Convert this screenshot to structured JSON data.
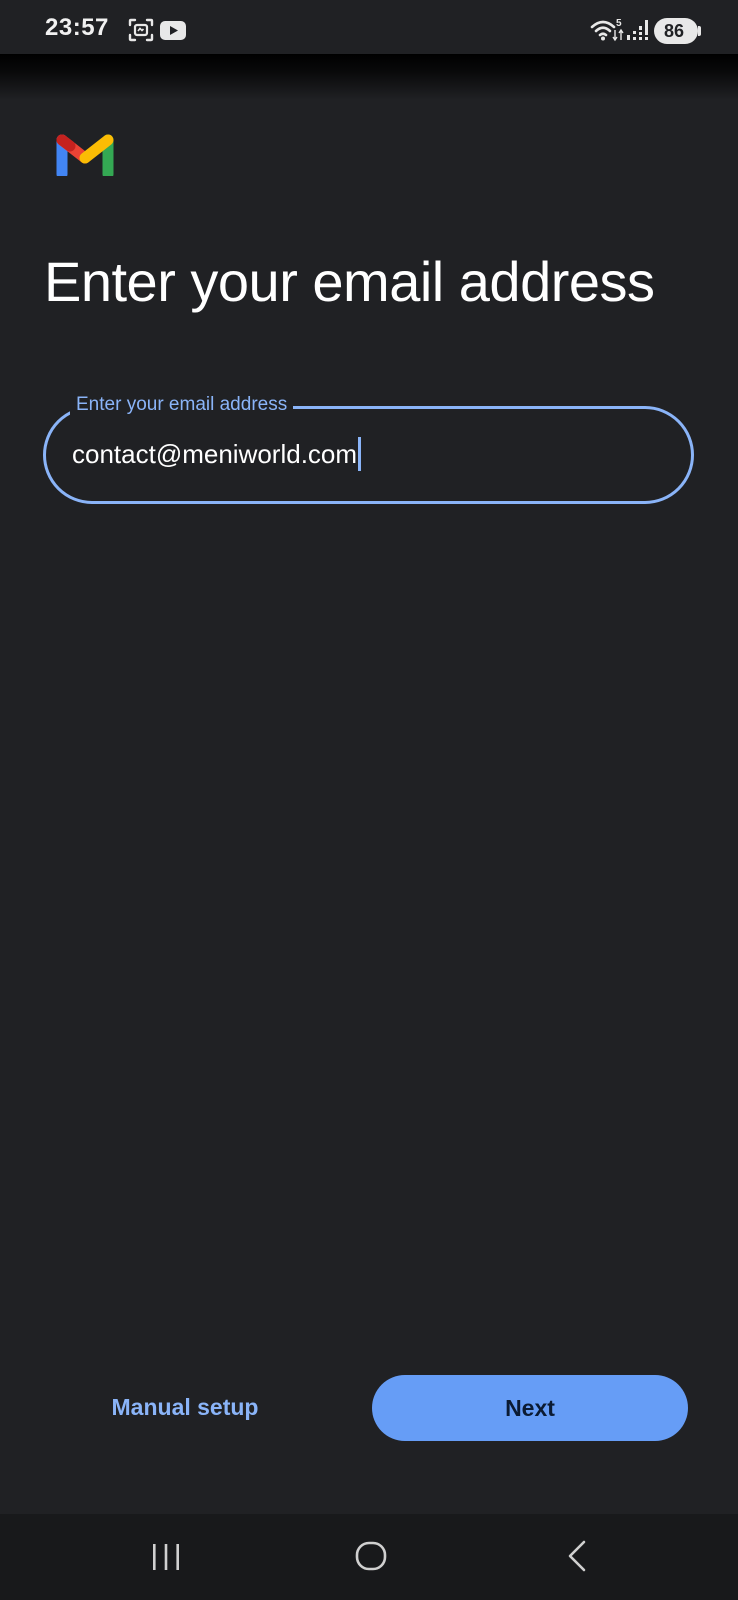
{
  "status_bar": {
    "time": "23:57",
    "battery_level": "86",
    "wifi_badge": "5",
    "icons": [
      "screen-recorder-icon",
      "youtube-icon",
      "wifi-icon",
      "signal-icon",
      "battery-icon"
    ]
  },
  "app": {
    "logo": "gmail-logo"
  },
  "page": {
    "title": "Enter your email address"
  },
  "email_field": {
    "label": "Enter your email address",
    "value": "contact@meniworld.com",
    "focused": true
  },
  "actions": {
    "manual_setup_label": "Manual setup",
    "next_label": "Next"
  },
  "nav_bar": {
    "icons": [
      "recent-apps-icon",
      "home-icon",
      "back-icon"
    ]
  },
  "colors": {
    "background": "#202124",
    "accent": "#8ab4f8",
    "button_fill": "#669df6",
    "nav_background": "#18191b"
  }
}
